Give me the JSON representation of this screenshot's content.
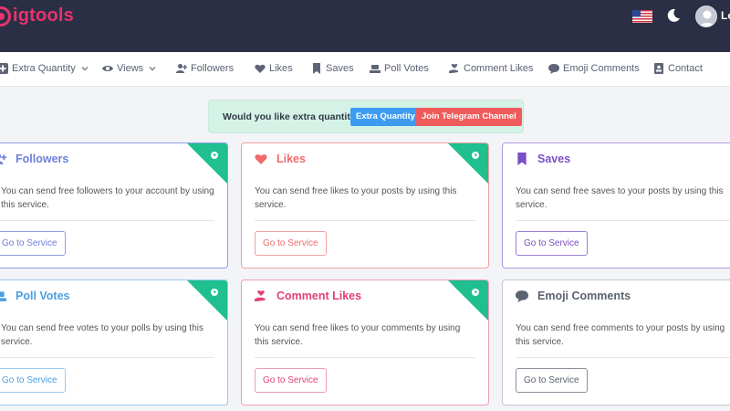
{
  "header": {
    "logo_text": "igtools",
    "login_label": "Lo",
    "brand_color": "#e8336e"
  },
  "nav": {
    "items": [
      {
        "label": "Extra Quantity",
        "icon": "plus-square-icon",
        "has_dropdown": true
      },
      {
        "label": "Views",
        "icon": "eye-icon",
        "has_dropdown": true
      },
      {
        "label": "Followers",
        "icon": "user-plus-icon"
      },
      {
        "label": "Likes",
        "icon": "heart-icon"
      },
      {
        "label": "Saves",
        "icon": "bookmark-icon"
      },
      {
        "label": "Poll Votes",
        "icon": "poll-icon"
      },
      {
        "label": "Comment Likes",
        "icon": "hand-heart-icon"
      },
      {
        "label": "Emoji Comments",
        "icon": "comment-icon"
      },
      {
        "label": "Contact",
        "icon": "contact-icon"
      }
    ]
  },
  "alert": {
    "text": "Would you like extra quantity?",
    "extra_button": "Extra Quantity",
    "telegram_button": "Join Telegram Channel"
  },
  "cards": [
    {
      "title": "Followers",
      "desc": "You can send free followers to your account by using this service.",
      "button": "Go to Service",
      "color": "#6c7fd8",
      "icon": "user-plus-icon"
    },
    {
      "title": "Likes",
      "desc": "You can send free likes to your posts by using this service.",
      "button": "Go to Service",
      "color": "#ef6b6b",
      "icon": "heart-icon"
    },
    {
      "title": "Saves",
      "desc": "You can send free saves to your posts by using this service.",
      "button": "Go to Service",
      "color": "#7b4fc4",
      "icon": "bookmark-icon"
    },
    {
      "title": "Poll Votes",
      "desc": "You can send free votes to your polls by using this service.",
      "button": "Go to Service",
      "color": "#4b9fe1",
      "icon": "poll-icon"
    },
    {
      "title": "Comment Likes",
      "desc": "You can send free likes to your comments by using this service.",
      "button": "Go to Service",
      "color": "#e0407a",
      "icon": "hand-heart-icon"
    },
    {
      "title": "Emoji Comments",
      "desc": "You can send free comments to your posts by using this service.",
      "button": "Go to Service",
      "color": "#5b6270",
      "icon": "comment-icon"
    }
  ],
  "ribbon_color": "#1fbf8f"
}
